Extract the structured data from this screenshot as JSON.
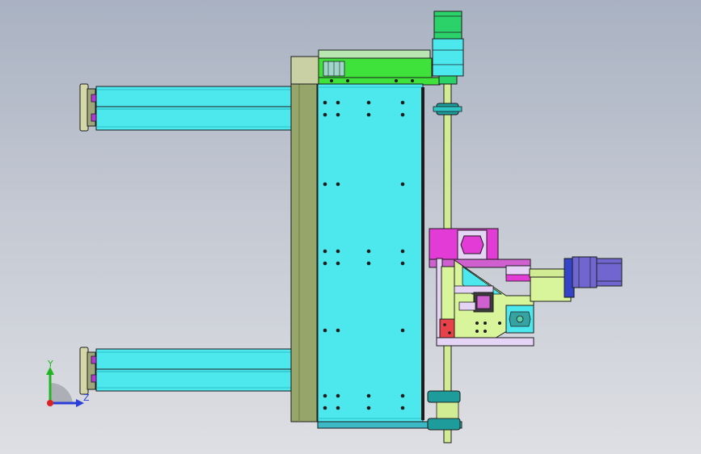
{
  "viewport": {
    "background_top": "#a9b2c2",
    "background_bottom": "#dedfe4"
  },
  "colors": {
    "cyan": "#4de8ee",
    "cyan_dark": "#23b5be",
    "olive": "#96a56a",
    "green": "#3ee23a",
    "magenta": "#e33bd6",
    "lime": "#d8f59c",
    "lavender": "#e6d4f6",
    "red": "#e8414a",
    "purple": "#7066cf",
    "motor_green": "#2bd26a",
    "rod": "#d2ec94",
    "outline": "#1c1c1c"
  },
  "triad": {
    "y_label": "Y",
    "z_label": "Z",
    "y_color": "#21b521",
    "z_color": "#2a3fd9",
    "x_color": "#d92323"
  }
}
